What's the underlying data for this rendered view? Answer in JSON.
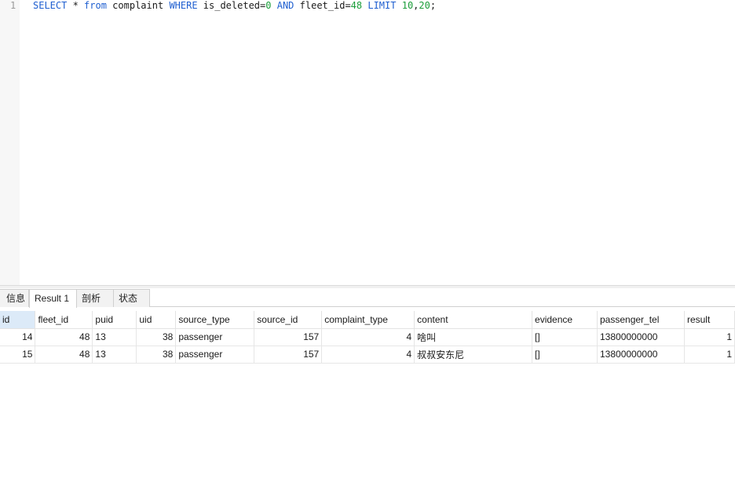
{
  "editor": {
    "line_number": "1",
    "tokens": [
      {
        "text": "SELECT",
        "color": "#1f5fd0"
      },
      {
        "text": " * ",
        "color": "#1a1a1a"
      },
      {
        "text": "from",
        "color": "#1f5fd0"
      },
      {
        "text": " complaint ",
        "color": "#1a1a1a"
      },
      {
        "text": "WHERE",
        "color": "#1f5fd0"
      },
      {
        "text": " is_deleted=",
        "color": "#1a1a1a"
      },
      {
        "text": "0",
        "color": "#1b9d3a"
      },
      {
        "text": " ",
        "color": "#1a1a1a"
      },
      {
        "text": "AND",
        "color": "#1f5fd0"
      },
      {
        "text": " fleet_id=",
        "color": "#1a1a1a"
      },
      {
        "text": "48",
        "color": "#1b9d3a"
      },
      {
        "text": " ",
        "color": "#1a1a1a"
      },
      {
        "text": "LIMIT",
        "color": "#1f5fd0"
      },
      {
        "text": " ",
        "color": "#1a1a1a"
      },
      {
        "text": "10",
        "color": "#1b9d3a"
      },
      {
        "text": ",",
        "color": "#1a1a1a"
      },
      {
        "text": "20",
        "color": "#1b9d3a"
      },
      {
        "text": ";",
        "color": "#1a1a1a"
      }
    ]
  },
  "tabs": {
    "info": "信息",
    "result1": "Result 1",
    "profile": "剖析",
    "status": "状态"
  },
  "result": {
    "columns": [
      "id",
      "fleet_id",
      "puid",
      "uid",
      "source_type",
      "source_id",
      "complaint_type",
      "content",
      "evidence",
      "passenger_tel",
      "result"
    ],
    "rows": [
      [
        "14",
        "48",
        "13",
        "38",
        "passenger",
        "157",
        "4",
        "啥叫",
        "[]",
        "13800000000",
        "1"
      ],
      [
        "15",
        "48",
        "13",
        "38",
        "passenger",
        "157",
        "4",
        "叔叔安东尼",
        "[]",
        "13800000000",
        "1"
      ]
    ]
  }
}
